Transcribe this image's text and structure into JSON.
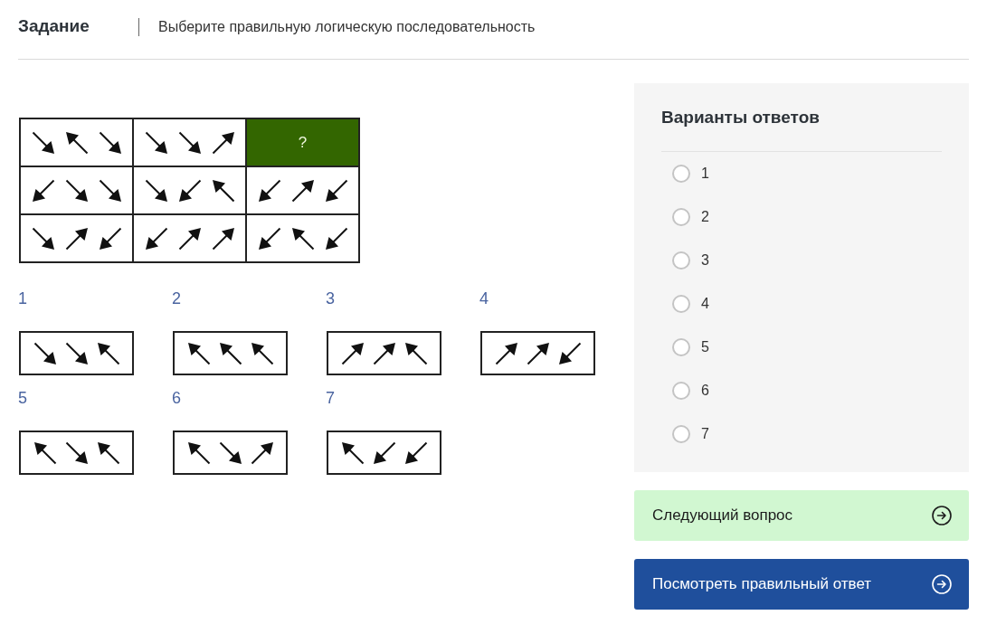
{
  "header": {
    "title": "Задание",
    "instruction": "Выберите правильную логическую последовательность"
  },
  "puzzle": {
    "rows": [
      {
        "cells": [
          {
            "kind": "arrows",
            "arrows": [
              {
                "kind": "se"
              },
              {
                "kind": "nw"
              },
              {
                "kind": "se"
              }
            ]
          },
          {
            "kind": "arrows",
            "arrows": [
              {
                "kind": "se"
              },
              {
                "kind": "se"
              },
              {
                "kind": "ne"
              }
            ]
          },
          {
            "kind": "question",
            "label": "?"
          }
        ]
      },
      {
        "cells": [
          {
            "kind": "arrows",
            "arrows": [
              {
                "kind": "sw"
              },
              {
                "kind": "se"
              },
              {
                "kind": "se"
              }
            ]
          },
          {
            "kind": "arrows",
            "arrows": [
              {
                "kind": "se"
              },
              {
                "kind": "sw"
              },
              {
                "kind": "nw"
              }
            ]
          },
          {
            "kind": "arrows",
            "arrows": [
              {
                "kind": "sw"
              },
              {
                "kind": "ne"
              },
              {
                "kind": "sw"
              }
            ]
          }
        ]
      },
      {
        "cells": [
          {
            "kind": "arrows",
            "arrows": [
              {
                "kind": "se"
              },
              {
                "kind": "ne"
              },
              {
                "kind": "sw"
              }
            ]
          },
          {
            "kind": "arrows",
            "arrows": [
              {
                "kind": "sw"
              },
              {
                "kind": "ne"
              },
              {
                "kind": "ne"
              }
            ]
          },
          {
            "kind": "arrows",
            "arrows": [
              {
                "kind": "sw"
              },
              {
                "kind": "nw"
              },
              {
                "kind": "sw"
              }
            ]
          }
        ]
      }
    ]
  },
  "options": [
    {
      "label": "1",
      "arrows": [
        {
          "kind": "se"
        },
        {
          "kind": "se"
        },
        {
          "kind": "nw"
        }
      ]
    },
    {
      "label": "2",
      "arrows": [
        {
          "kind": "nw"
        },
        {
          "kind": "nw"
        },
        {
          "kind": "nw"
        }
      ]
    },
    {
      "label": "3",
      "arrows": [
        {
          "kind": "ne"
        },
        {
          "kind": "ne"
        },
        {
          "kind": "nw"
        }
      ]
    },
    {
      "label": "4",
      "arrows": [
        {
          "kind": "ne"
        },
        {
          "kind": "ne"
        },
        {
          "kind": "sw"
        }
      ]
    },
    {
      "label": "5",
      "arrows": [
        {
          "kind": "nw"
        },
        {
          "kind": "se"
        },
        {
          "kind": "nw"
        }
      ]
    },
    {
      "label": "6",
      "arrows": [
        {
          "kind": "nw"
        },
        {
          "kind": "se"
        },
        {
          "kind": "ne"
        }
      ]
    },
    {
      "label": "7",
      "arrows": [
        {
          "kind": "nw"
        },
        {
          "kind": "sw"
        },
        {
          "kind": "sw"
        }
      ]
    }
  ],
  "answers_panel": {
    "title": "Варианты ответов",
    "choices": [
      {
        "label": "1",
        "selected": false
      },
      {
        "label": "2",
        "selected": false
      },
      {
        "label": "3",
        "selected": false
      },
      {
        "label": "4",
        "selected": false
      },
      {
        "label": "5",
        "selected": false
      },
      {
        "label": "6",
        "selected": false
      },
      {
        "label": "7",
        "selected": false
      }
    ]
  },
  "buttons": [
    {
      "label": "Следующий вопрос",
      "kind": "secondary"
    },
    {
      "label": "Посмотреть правильный ответ",
      "kind": "primary"
    }
  ]
}
